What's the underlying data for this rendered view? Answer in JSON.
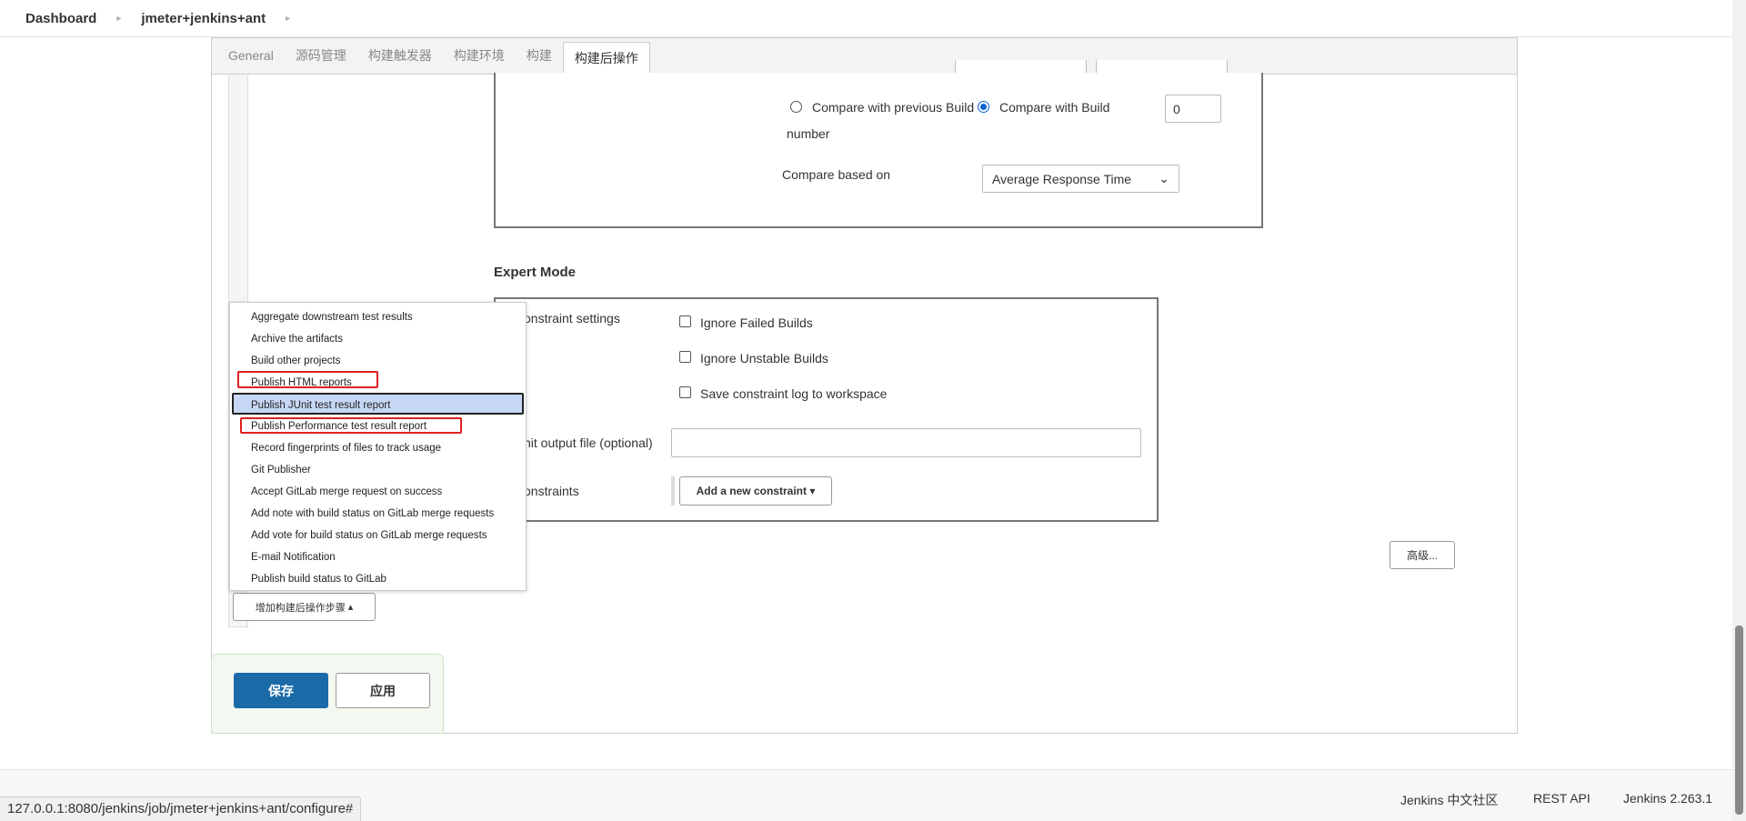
{
  "breadcrumb": {
    "items": [
      "Dashboard",
      "jmeter+jenkins+ant"
    ]
  },
  "tabs": [
    "General",
    "源码管理",
    "构建触发器",
    "构建环境",
    "构建",
    "构建后操作"
  ],
  "active_tab": "构建后操作",
  "compare": {
    "option_previous": "Compare with previous Build",
    "option_build_number_1": "Compare with Build",
    "option_build_number_2": "number",
    "selected": "Compare with Build number",
    "build_number_value": "0",
    "based_on_label": "Compare based on",
    "based_on_value": "Average Response Time"
  },
  "expert_mode": {
    "heading": "Expert Mode",
    "constraint_settings_label": "onstraint settings",
    "ignore_failed": "Ignore Failed Builds",
    "ignore_unstable": "Ignore Unstable Builds",
    "save_log": "Save constraint log to workspace",
    "junit_output_label": "nit output file (optional)",
    "junit_output_value": "",
    "constraints_label": "onstraints",
    "add_constraint_button": "Add a new constraint"
  },
  "advanced_button": "高级...",
  "add_post_build_button": "增加构建后操作步骤",
  "post_build_menu": {
    "items": [
      "Aggregate downstream test results",
      "Archive the artifacts",
      "Build other projects",
      "Publish HTML reports",
      "Publish JUnit test result report",
      "Publish Performance test result report",
      "Record fingerprints of files to track usage",
      "Git Publisher",
      "Accept GitLab merge request on success",
      "Add note with build status on GitLab merge requests",
      "Add vote for build status on GitLab merge requests",
      "E-mail Notification",
      "Publish build status to GitLab"
    ],
    "highlighted": "Publish JUnit test result report",
    "annotated": [
      "Publish HTML reports",
      "Publish Performance test result report"
    ]
  },
  "actions": {
    "save": "保存",
    "apply": "应用"
  },
  "footer": {
    "community": "Jenkins 中文社区",
    "rest_api": "REST API",
    "version": "Jenkins 2.263.1"
  },
  "status_url": "127.0.0.1:8080/jenkins/job/jmeter+jenkins+ant/configure#",
  "colors": {
    "primary_button": "#1b6aa8",
    "annotation_red": "#e02020",
    "menu_highlight": "#c6d7f5"
  }
}
